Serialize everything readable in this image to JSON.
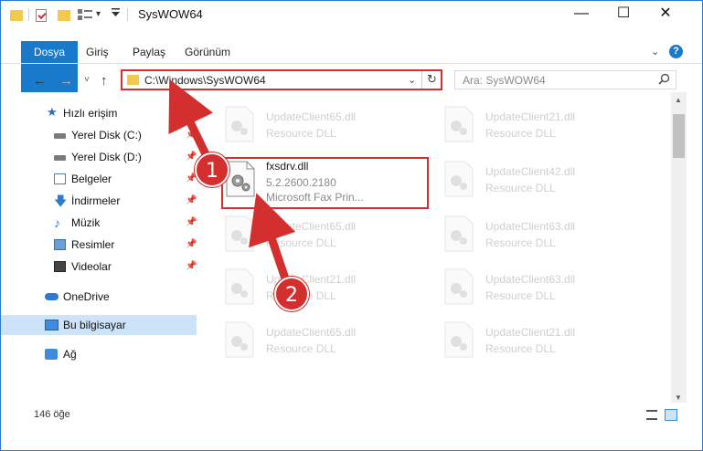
{
  "window": {
    "title": "SysWOW64",
    "minimize": "—",
    "maximize": "☐",
    "close": "✕"
  },
  "quick_access_toolbar": {
    "dropdown_glyph": "▾"
  },
  "ribbon": {
    "tabs": [
      "Dosya",
      "Giriş",
      "Paylaş",
      "Görünüm"
    ],
    "collapse_glyph": "⌄",
    "help": "?"
  },
  "navigation": {
    "back": "←",
    "forward": "→",
    "recent": "˅",
    "up": "↑",
    "address": "C:\\Windows\\SysWOW64",
    "address_dropdown": "⌄",
    "refresh": "↻",
    "search_placeholder": "Ara: SysWOW64",
    "search_icon": "⚲"
  },
  "sidebar": {
    "items": [
      {
        "label": "Hızlı erişim",
        "icon": "star-icon",
        "pinned": false
      },
      {
        "label": "Yerel Disk (C:)",
        "icon": "drive-icon",
        "pinned": true
      },
      {
        "label": "Yerel Disk (D:)",
        "icon": "drive-icon",
        "pinned": true
      },
      {
        "label": "Belgeler",
        "icon": "documents-icon",
        "pinned": true
      },
      {
        "label": "İndirmeler",
        "icon": "download-icon",
        "pinned": true
      },
      {
        "label": "Müzik",
        "icon": "music-icon",
        "pinned": true
      },
      {
        "label": "Resimler",
        "icon": "pictures-icon",
        "pinned": true
      },
      {
        "label": "Videolar",
        "icon": "videos-icon",
        "pinned": true
      },
      {
        "label": "OneDrive",
        "icon": "cloud-icon",
        "pinned": false
      },
      {
        "label": "Bu bilgisayar",
        "icon": "computer-icon",
        "pinned": false,
        "selected": true
      },
      {
        "label": "Ağ",
        "icon": "network-icon",
        "pinned": false
      }
    ],
    "pin_glyph": "📌"
  },
  "files": [
    {
      "name": "UpdateClient65.dll",
      "desc": "Resource DLL"
    },
    {
      "name": "UpdateClient21.dll",
      "desc": "Resource DLL"
    },
    {
      "name": "UpdateClient42.dll",
      "desc": "Resource DLL"
    },
    {
      "name": "UpdateClient65.dll",
      "desc": "Resource DLL"
    },
    {
      "name": "UpdateClient63.dll",
      "desc": "Resource DLL"
    },
    {
      "name": "UpdateClient21.dll",
      "desc": "Resource DLL"
    },
    {
      "name": "UpdateClient63.dll",
      "desc": "Resource DLL"
    },
    {
      "name": "UpdateClient65.dll",
      "desc": "Resource DLL"
    },
    {
      "name": "UpdateClient21.dll",
      "desc": "Resource DLL"
    }
  ],
  "focused_file": {
    "name": "fxsdrv.dll",
    "version": "5.2.2600.2180",
    "description": "Microsoft  Fax Prin..."
  },
  "scrollbar": {
    "up": "▲",
    "down": "▼"
  },
  "status": {
    "item_count": "146 öğe"
  },
  "annotations": {
    "step1": "1",
    "step2": "2",
    "color": "#d32f2f"
  }
}
